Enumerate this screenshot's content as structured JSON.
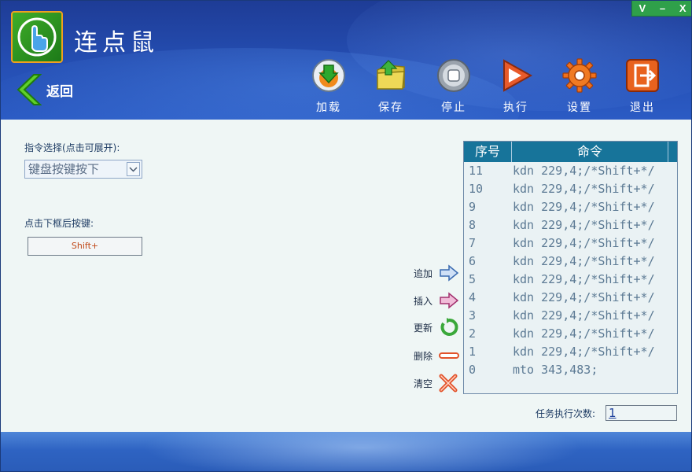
{
  "app": {
    "title": "连点鼠",
    "window_controls": [
      "V",
      "–",
      "X"
    ],
    "back_label": "返回"
  },
  "toolbar": {
    "load": "加载",
    "save": "保存",
    "stop": "停止",
    "run": "执行",
    "settings": "设置",
    "exit": "退出"
  },
  "left_panel": {
    "command_select_label": "指令选择(点击可展开):",
    "command_selected": "键盘按键按下",
    "key_prompt_label": "点击下框后按键:",
    "key_value": "Shift+"
  },
  "actions": {
    "append": "追加",
    "insert": "插入",
    "update": "更新",
    "delete": "删除",
    "clear": "清空"
  },
  "command_list": {
    "headers": {
      "index": "序号",
      "command": "命令"
    },
    "rows": [
      {
        "index": "11",
        "command": "kdn 229,4;/*Shift+*/"
      },
      {
        "index": "10",
        "command": "kdn 229,4;/*Shift+*/"
      },
      {
        "index": "9",
        "command": "kdn 229,4;/*Shift+*/"
      },
      {
        "index": "8",
        "command": "kdn 229,4;/*Shift+*/"
      },
      {
        "index": "7",
        "command": "kdn 229,4;/*Shift+*/"
      },
      {
        "index": "6",
        "command": "kdn 229,4;/*Shift+*/"
      },
      {
        "index": "5",
        "command": "kdn 229,4;/*Shift+*/"
      },
      {
        "index": "4",
        "command": "kdn 229,4;/*Shift+*/"
      },
      {
        "index": "3",
        "command": "kdn 229,4;/*Shift+*/"
      },
      {
        "index": "2",
        "command": "kdn 229,4;/*Shift+*/"
      },
      {
        "index": "1",
        "command": "kdn 229,4;/*Shift+*/"
      },
      {
        "index": "0",
        "command": "mto 343,483;"
      }
    ]
  },
  "run_count": {
    "label": "任务执行次数:",
    "value": "1"
  },
  "icons": {
    "logo": "hand-pointer-icon",
    "back": "chevron-left-icon",
    "load": "download-arrow-icon",
    "save": "folder-icon",
    "stop": "stop-icon",
    "run": "play-icon",
    "settings": "gear-icon",
    "exit": "exit-door-icon"
  },
  "colors": {
    "header": "#254fb4",
    "list_header": "#17749a",
    "window_controls": "#2fa04a",
    "main_bg": "#eff6f5"
  }
}
